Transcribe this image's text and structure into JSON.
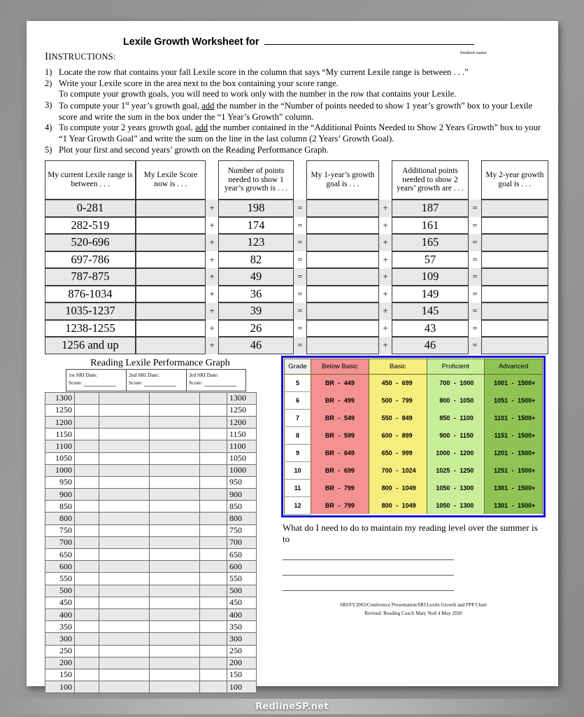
{
  "document": {
    "title": "Lexile Growth Worksheet for",
    "student_name_label": "Student name",
    "instructions_label": "INSTRUCTIONS:",
    "instructions": [
      {
        "num": "1)",
        "text": "Locate the row that contains your fall Lexile score in the column that says “My current Lexile range is between . . .”"
      },
      {
        "num": "2)",
        "text": "Write your Lexile score in the area next to the box containing your score range.\nTo compute your growth goals, you will need to work only with the number in the row that contains your Lexile."
      },
      {
        "num": "3)",
        "text": "To compute your 1st year’s growth goal, add the number in the “Number of points needed to show 1 year’s growth” box to your Lexile score and write the sum in the box under the “1 Year’s Growth” column."
      },
      {
        "num": "4)",
        "text": "To compute your 2 years growth goal, add the number contained in the “Additional Points Needed to Show 2 Years Growth” box to your “1 Year Growth Goal” and write the sum on the line in the last column (2 Years’ Growth Goal)."
      },
      {
        "num": "5)",
        "text": "Plot your first and second years’ growth on the Reading Performance Graph."
      }
    ]
  },
  "growth_table": {
    "headers": [
      "My current Lexile range is between . . .",
      "My Lexile Score now is . . .",
      "Number of points needed to show 1 year’s growth is . . .",
      "My 1-year’s growth goal is . . .",
      "Additional points needed to show 2 years’ growth are . . .",
      "My 2-year growth goal is . . ."
    ],
    "operators": {
      "plus": "+",
      "equals": "="
    },
    "rows": [
      {
        "range": "0-281",
        "score": "",
        "points_1yr": "198",
        "goal_1yr": "",
        "points_2yr": "187",
        "goal_2yr": ""
      },
      {
        "range": "282-519",
        "score": "",
        "points_1yr": "174",
        "goal_1yr": "",
        "points_2yr": "161",
        "goal_2yr": ""
      },
      {
        "range": "520-696",
        "score": "",
        "points_1yr": "123",
        "goal_1yr": "",
        "points_2yr": "165",
        "goal_2yr": ""
      },
      {
        "range": "697-786",
        "score": "",
        "points_1yr": "82",
        "goal_1yr": "",
        "points_2yr": "57",
        "goal_2yr": ""
      },
      {
        "range": "787-875",
        "score": "",
        "points_1yr": "49",
        "goal_1yr": "",
        "points_2yr": "109",
        "goal_2yr": ""
      },
      {
        "range": "876-1034",
        "score": "",
        "points_1yr": "36",
        "goal_1yr": "",
        "points_2yr": "149",
        "goal_2yr": ""
      },
      {
        "range": "1035-1237",
        "score": "",
        "points_1yr": "39",
        "goal_1yr": "",
        "points_2yr": "145",
        "goal_2yr": ""
      },
      {
        "range": "1238-1255",
        "score": "",
        "points_1yr": "26",
        "goal_1yr": "",
        "points_2yr": "43",
        "goal_2yr": ""
      },
      {
        "range": "1256 and up",
        "score": "",
        "points_1yr": "46",
        "goal_1yr": "",
        "points_2yr": "46",
        "goal_2yr": ""
      }
    ]
  },
  "performance_graph": {
    "title": "Reading Lexile Performance Graph",
    "sri_boxes": [
      {
        "date_label": "1st SRI Date:",
        "score_label": "Score:"
      },
      {
        "date_label": "2nd SRI Date:",
        "score_label": "Score:"
      },
      {
        "date_label": "3rd SRI Date:",
        "score_label": "Score:"
      }
    ],
    "scale": [
      "1300",
      "1250",
      "1200",
      "1150",
      "1100",
      "1050",
      "1000",
      "950",
      "900",
      "850",
      "800",
      "750",
      "700",
      "650",
      "600",
      "550",
      "500",
      "450",
      "400",
      "350",
      "300",
      "250",
      "200",
      "150",
      "100"
    ]
  },
  "proficiency_chart": {
    "border_color": "#1414d2",
    "columns": [
      {
        "label": "Grade",
        "color": "#ffffff"
      },
      {
        "label": "Below Basic",
        "color": "#f49191"
      },
      {
        "label": "Basic",
        "color": "#f5ed7e"
      },
      {
        "label": "Proficient",
        "color": "#c8ee9a"
      },
      {
        "label": "Advanced",
        "color": "#8fc455"
      }
    ],
    "dash": "-",
    "rows": [
      {
        "grade": "5",
        "below_basic": [
          "BR",
          "449"
        ],
        "basic": [
          "450",
          "699"
        ],
        "proficient": [
          "700",
          "1000"
        ],
        "advanced": [
          "1001",
          "1500+"
        ]
      },
      {
        "grade": "6",
        "below_basic": [
          "BR",
          "499"
        ],
        "basic": [
          "500",
          "799"
        ],
        "proficient": [
          "800",
          "1050"
        ],
        "advanced": [
          "1051",
          "1500+"
        ]
      },
      {
        "grade": "7",
        "below_basic": [
          "BR",
          "549"
        ],
        "basic": [
          "550",
          "849"
        ],
        "proficient": [
          "850",
          "1100"
        ],
        "advanced": [
          "1101",
          "1500+"
        ]
      },
      {
        "grade": "8",
        "below_basic": [
          "BR",
          "599"
        ],
        "basic": [
          "600",
          "899"
        ],
        "proficient": [
          "900",
          "1150"
        ],
        "advanced": [
          "1151",
          "1500+"
        ]
      },
      {
        "grade": "9",
        "below_basic": [
          "BR",
          "649"
        ],
        "basic": [
          "650",
          "999"
        ],
        "proficient": [
          "1000",
          "1200"
        ],
        "advanced": [
          "1201",
          "1500+"
        ]
      },
      {
        "grade": "10",
        "below_basic": [
          "BR",
          "699"
        ],
        "basic": [
          "700",
          "1024"
        ],
        "proficient": [
          "1025",
          "1250"
        ],
        "advanced": [
          "1251",
          "1500+"
        ]
      },
      {
        "grade": "11",
        "below_basic": [
          "BR",
          "799"
        ],
        "basic": [
          "800",
          "1049"
        ],
        "proficient": [
          "1050",
          "1300"
        ],
        "advanced": [
          "1301",
          "1500+"
        ]
      },
      {
        "grade": "12",
        "below_basic": [
          "BR",
          "799"
        ],
        "basic": [
          "800",
          "1049"
        ],
        "proficient": [
          "1050",
          "1300"
        ],
        "advanced": [
          "1301",
          "1500+"
        ]
      }
    ]
  },
  "reflection": {
    "question": "What do I need to do to maintain my reading level over the summer is to"
  },
  "footer": {
    "line1": "SRI/FY2003/Conference Presentation/SRI Lexile Growth and PPP Chart",
    "line2": "Revised: Reading Coach Mary Null 4 May 2020"
  },
  "watermark": {
    "text": "RedlineSP.net"
  }
}
